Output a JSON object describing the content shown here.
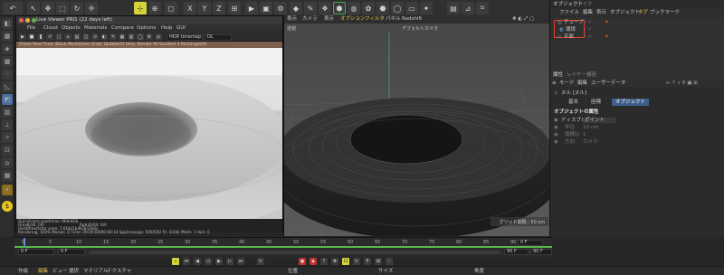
{
  "live_viewer": {
    "title": "Live Viewer PRI1 (22 days left)",
    "menu": [
      "File",
      "Cloud",
      "Objects",
      "Materials",
      "Compare",
      "Options",
      "Help",
      "GUI"
    ],
    "tonemap": "HDR tonemap",
    "tonemap_mode": "DL",
    "status_line": "Check Real Time, Block Mesh(Gen) Grab; Update(5) time, Render fill Scrolled 3 Rectangle(0)",
    "info": {
      "line1": "Out-of-core used/max: 0Kb/4Gb",
      "line2_left": "Grey8/16: 0/0",
      "line2_right": "Rgb32/64: 0/0",
      "line3": "Used/free/total vram: 7.6Gb/1b/8Gb/24Gb",
      "line4": "Rendering: 100%   Ms/sec: 0   Time: 00:00:00/00:00:14   Spp/maxspp: 500/500   Tri: 0/20k   Mesh: 1   Hair: 0"
    }
  },
  "viewport": {
    "menu": [
      "表示",
      "カメラ",
      "表示",
      "オプション",
      "フィルタ",
      "パネル",
      "Redshift"
    ],
    "view_label": "透視",
    "camera_label": "デフォルトカメラ",
    "grid_label": "グリッド間隔 : 50 cm"
  },
  "object_manager": {
    "tabs": [
      "オブジェクト",
      "テイク"
    ],
    "menu": [
      "ファイル",
      "編集",
      "表示",
      "オブジェクト",
      "タグ",
      "ブックマーク"
    ],
    "objects": [
      "チューブ",
      "環境",
      "平面"
    ]
  },
  "attributes": {
    "tabs": [
      "属性",
      "レイヤー",
      "構造"
    ],
    "menu": [
      "モード",
      "編集",
      "ユーザーデータ"
    ],
    "object_title": "ヌル [ヌル]",
    "sub_tabs": [
      "基本",
      "座標",
      "オブジェクト"
    ],
    "section_title": "オブジェクトの属性",
    "rows": [
      {
        "label": "ドィスプレイ",
        "value": "ポイント"
      },
      {
        "label": "半径",
        "value": "10 cm"
      },
      {
        "label": "縦横比",
        "value": "1"
      },
      {
        "label": "方向",
        "value": "カメラ"
      }
    ]
  },
  "timeline": {
    "ticks": [
      "0",
      "5",
      "10",
      "15",
      "20",
      "25",
      "30",
      "35",
      "40",
      "45",
      "50",
      "55",
      "60",
      "65",
      "70",
      "75",
      "80",
      "85",
      "90"
    ],
    "current_frame": "0 F",
    "start_frame": "0 F",
    "end_frame": "90 F",
    "end_frame_2": "90 F",
    "frame_right": "0 F"
  },
  "bottom": {
    "left_menu": [
      "作成",
      "編集",
      "ビュー",
      "選択",
      "マテリアル",
      "テクスチャ"
    ],
    "position": "位置",
    "size": "サイズ",
    "angle": "角度"
  },
  "colors": {
    "accent_yellow": "#d6d23a",
    "highlight_red": "#e0442a",
    "status_brown": "#7a5f4d",
    "timeline_green": "#57b84a"
  }
}
